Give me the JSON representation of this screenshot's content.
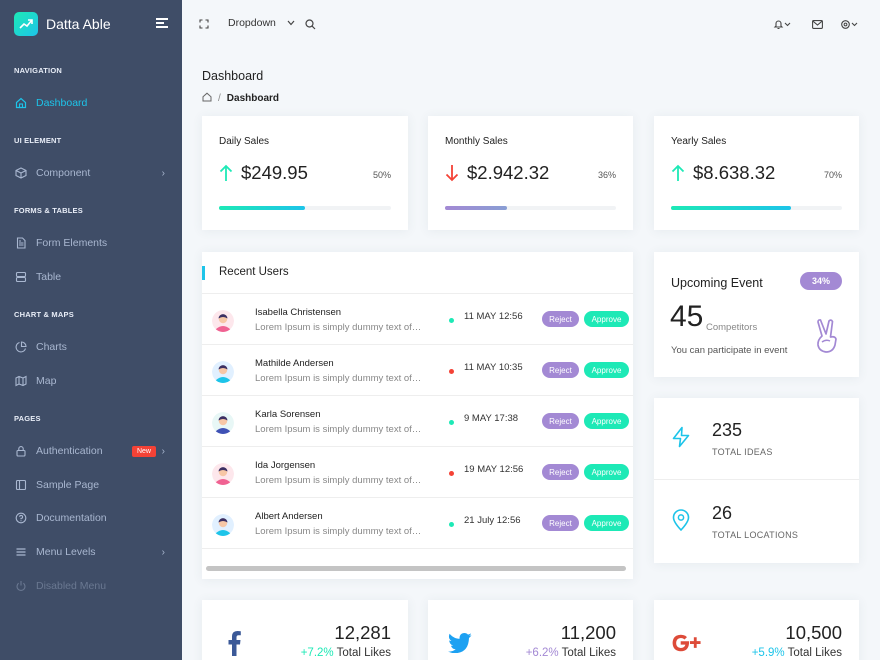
{
  "app": {
    "brand": "Datta Able"
  },
  "colors": {
    "sidebar": "#3f4d67",
    "accent": "#1dc4e9",
    "green": "#1de9b6",
    "purple": "#a389d4",
    "red": "#f44236"
  },
  "sidebar": {
    "sections": [
      "NAVIGATION",
      "UI ELEMENT",
      "FORMS & TABLES",
      "CHART & MAPS",
      "PAGES"
    ],
    "items": [
      {
        "label": "Dashboard",
        "icon": "home-icon"
      },
      {
        "label": "Component",
        "icon": "box-icon"
      },
      {
        "label": "Form Elements",
        "icon": "file-icon"
      },
      {
        "label": "Table",
        "icon": "server-icon"
      },
      {
        "label": "Charts",
        "icon": "pie-chart-icon"
      },
      {
        "label": "Map",
        "icon": "map-icon"
      },
      {
        "label": "Authentication",
        "icon": "lock-icon",
        "badge": "New"
      },
      {
        "label": "Sample Page",
        "icon": "sidebar-icon"
      },
      {
        "label": "Documentation",
        "icon": "help-icon"
      },
      {
        "label": "Menu Levels",
        "icon": "menu-icon"
      },
      {
        "label": "Disabled Menu",
        "icon": "power-icon"
      }
    ]
  },
  "header": {
    "dropdown_label": "Dropdown"
  },
  "page": {
    "title": "Dashboard",
    "breadcrumb_current": "Dashboard"
  },
  "stats": [
    {
      "title": "Daily Sales",
      "value": "$249.95",
      "percent": "50%",
      "progress": 0.5,
      "direction": "up"
    },
    {
      "title": "Monthly Sales",
      "value": "$2.942.32",
      "percent": "36%",
      "progress": 0.36,
      "direction": "down"
    },
    {
      "title": "Yearly Sales",
      "value": "$8.638.32",
      "percent": "70%",
      "progress": 0.7,
      "direction": "up"
    }
  ],
  "recent_users": {
    "title": "Recent Users",
    "reject_label": "Reject",
    "approve_label": "Approve",
    "rows": [
      {
        "name": "Isabella Christensen",
        "desc": "Lorem Ipsum is simply dummy text of…",
        "date": "11 MAY 12:56",
        "status": "green"
      },
      {
        "name": "Mathilde Andersen",
        "desc": "Lorem Ipsum is simply dummy text of…",
        "date": "11 MAY 10:35",
        "status": "red"
      },
      {
        "name": "Karla Sorensen",
        "desc": "Lorem Ipsum is simply dummy text of…",
        "date": "9 MAY 17:38",
        "status": "green"
      },
      {
        "name": "Ida Jorgensen",
        "desc": "Lorem Ipsum is simply dummy text of…",
        "date": "19 MAY 12:56",
        "status": "red"
      },
      {
        "name": "Albert Andersen",
        "desc": "Lorem Ipsum is simply dummy text of…",
        "date": "21 July 12:56",
        "status": "green"
      }
    ]
  },
  "event": {
    "title": "Upcoming Event",
    "badge": "34%",
    "count": "45",
    "count_label": "Competitors",
    "note": "You can participate in event"
  },
  "ideas": {
    "value": "235",
    "label": "TOTAL IDEAS"
  },
  "locations": {
    "value": "26",
    "label": "TOTAL LOCATIONS"
  },
  "social": [
    {
      "network": "facebook-icon",
      "value": "12,281",
      "change": "+7.2%",
      "label": "Total Likes"
    },
    {
      "network": "twitter-icon",
      "value": "11,200",
      "change": "+6.2%",
      "label": "Total Likes"
    },
    {
      "network": "google-plus-icon",
      "value": "10,500",
      "change": "+5.9%",
      "label": "Total Likes"
    }
  ]
}
